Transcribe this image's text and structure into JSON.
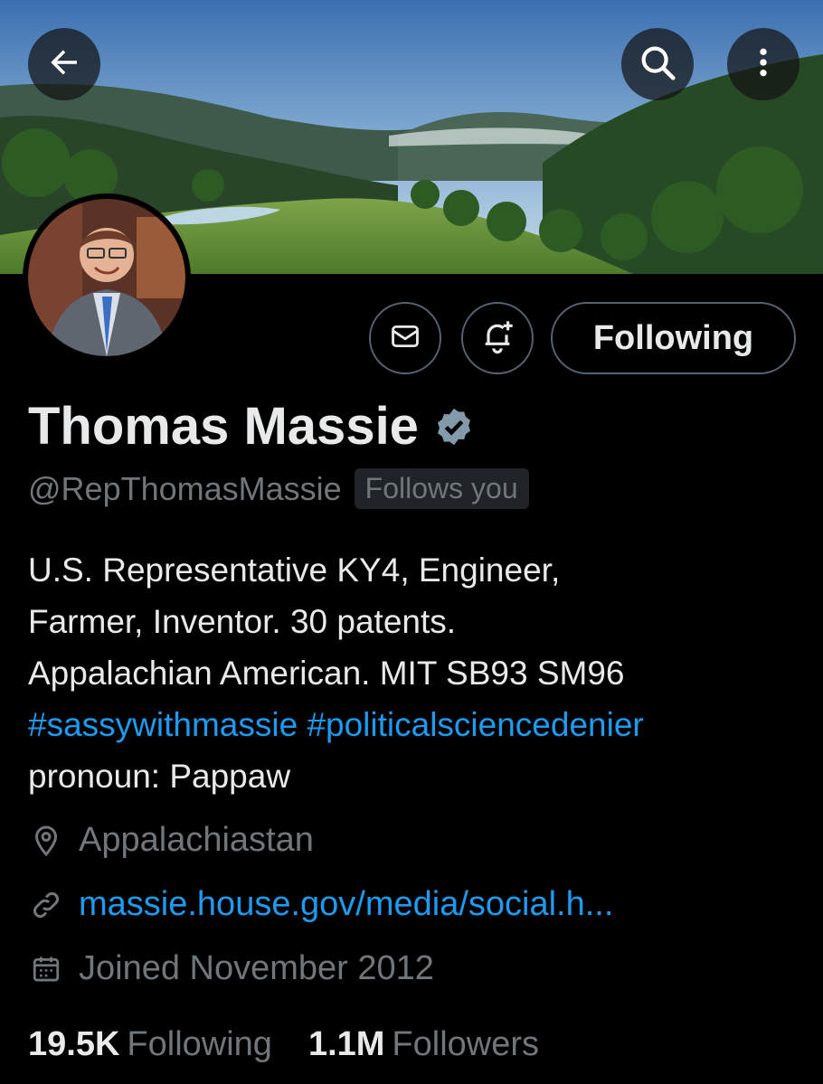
{
  "profile": {
    "name": "Thomas Massie",
    "handle": "@RepThomasMassie",
    "follows_you": "Follows you",
    "bio": {
      "line1": "U.S. Representative KY4, Engineer,",
      "line2": "Farmer, Inventor. 30 patents.",
      "line3": "Appalachian American. MIT SB93 SM96",
      "hashtag1": "#sassywithmassie",
      "hashtag2": "#politicalsciencedenier",
      "line5": "pronoun: Pappaw"
    },
    "location": "Appalachiastan",
    "website": "massie.house.gov/media/social.h...",
    "joined": "Joined November 2012",
    "following_count": "19.5K",
    "following_label": "Following",
    "followers_count": "1.1M",
    "followers_label": "Followers"
  },
  "actions": {
    "follow_button_label": "Following"
  },
  "icons": {
    "back": "arrow-left-icon",
    "search": "search-icon",
    "more": "more-vertical-icon",
    "message": "envelope-icon",
    "notify": "bell-plus-icon",
    "verified": "verified-badge-icon",
    "location": "location-pin-icon",
    "link": "link-icon",
    "calendar": "calendar-icon"
  },
  "colors": {
    "background": "#000000",
    "text_primary": "#e7e9ea",
    "text_secondary": "#71767b",
    "link": "#1d9bf0",
    "verified": "#829aab"
  }
}
